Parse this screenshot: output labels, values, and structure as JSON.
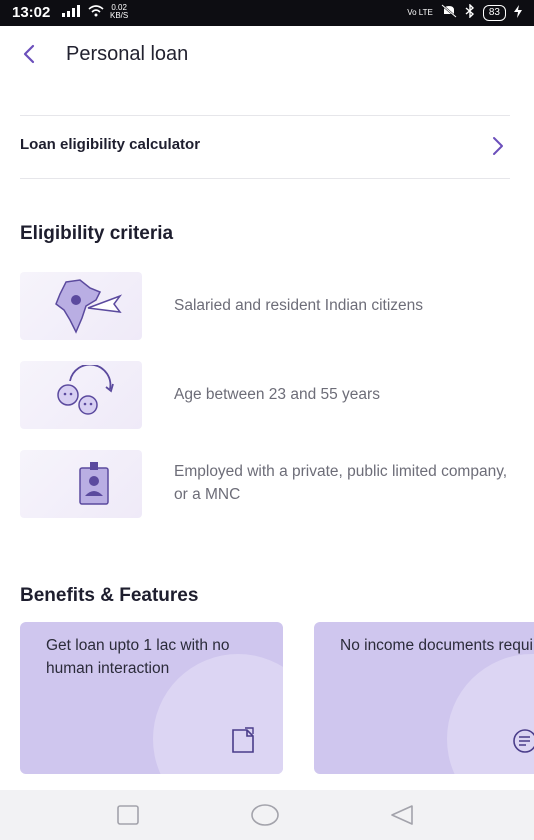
{
  "status_bar": {
    "time": "13:02",
    "data_speed": "0.02",
    "data_unit": "KB/S",
    "volte": "Vo LTE",
    "battery": "83"
  },
  "header": {
    "title": "Personal loan",
    "back_icon": "chevron-left-icon"
  },
  "calculator": {
    "label": "Loan eligibility calculator",
    "icon": "chevron-right-icon"
  },
  "eligibility": {
    "title": "Eligibility criteria",
    "items": [
      {
        "text": "Salaried and resident Indian citizens",
        "icon": "india-map-icon"
      },
      {
        "text": "Age between 23 and 55 years",
        "icon": "age-faces-icon"
      },
      {
        "text": "Employed with a private, public limited company, or a MNC",
        "icon": "id-badge-icon"
      }
    ]
  },
  "benefits": {
    "title": "Benefits & Features",
    "cards": [
      {
        "text": "Get loan upto 1 lac with no human interaction",
        "icon": "document-icon"
      },
      {
        "text": "No income documents required",
        "icon": "paper-icon"
      }
    ]
  },
  "nav_bar": {
    "buttons": [
      "recents-icon",
      "home-icon",
      "back-triangle-icon"
    ]
  },
  "colors": {
    "accent": "#6b4fbb",
    "card_bg": "#cfc6ee",
    "muted_text": "#6d6d78"
  }
}
